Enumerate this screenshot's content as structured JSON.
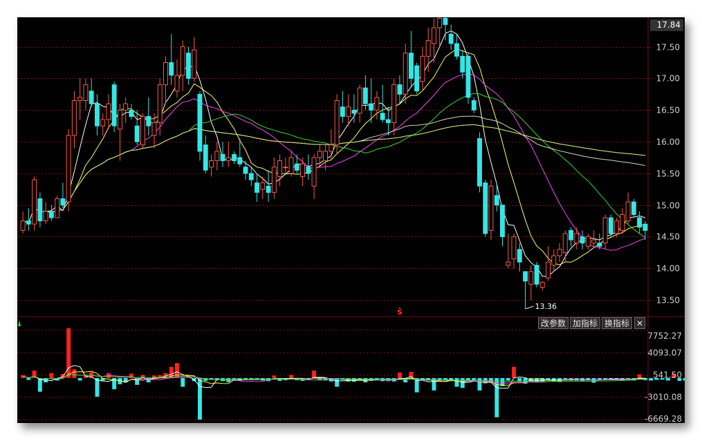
{
  "chart_data": {
    "type": "candlestick",
    "price_axis": {
      "ylim": [
        13.25,
        17.9
      ],
      "ticks": [
        "17.50",
        "17.00",
        "16.50",
        "16.00",
        "15.50",
        "15.00",
        "14.50",
        "14.00",
        "13.50"
      ],
      "current_label": "17.84"
    },
    "volume_axis": {
      "ylim": [
        -6669.28,
        7752.27
      ],
      "ticks": [
        "7752.27",
        "4093.07",
        "541.50",
        "-3010.08",
        "-6669.28"
      ]
    },
    "annotations": {
      "high_marker": "18.09",
      "low_marker": "13.36",
      "signal_marker": "ŝ"
    },
    "candles": [
      {
        "o": 14.6,
        "h": 14.9,
        "l": 14.55,
        "c": 14.75
      },
      {
        "o": 14.75,
        "h": 14.95,
        "l": 14.6,
        "c": 14.7
      },
      {
        "o": 14.7,
        "h": 15.45,
        "l": 14.6,
        "c": 15.4
      },
      {
        "o": 15.1,
        "h": 15.2,
        "l": 14.65,
        "c": 14.75
      },
      {
        "o": 14.75,
        "h": 15.05,
        "l": 14.7,
        "c": 14.9
      },
      {
        "o": 14.9,
        "h": 15.0,
        "l": 14.75,
        "c": 14.8
      },
      {
        "o": 14.8,
        "h": 15.15,
        "l": 14.8,
        "c": 15.1
      },
      {
        "o": 15.1,
        "h": 15.35,
        "l": 14.95,
        "c": 15.0
      },
      {
        "o": 15.05,
        "h": 16.2,
        "l": 14.9,
        "c": 16.1
      },
      {
        "o": 16.1,
        "h": 16.8,
        "l": 15.9,
        "c": 16.65
      },
      {
        "o": 16.65,
        "h": 17.0,
        "l": 16.35,
        "c": 16.7
      },
      {
        "o": 16.65,
        "h": 17.0,
        "l": 16.5,
        "c": 16.9
      },
      {
        "o": 16.8,
        "h": 17.0,
        "l": 16.55,
        "c": 16.6
      },
      {
        "o": 16.6,
        "h": 16.75,
        "l": 16.1,
        "c": 16.25
      },
      {
        "o": 16.25,
        "h": 16.45,
        "l": 16.1,
        "c": 16.35
      },
      {
        "o": 16.35,
        "h": 16.75,
        "l": 16.2,
        "c": 16.6
      },
      {
        "o": 16.9,
        "h": 16.95,
        "l": 16.15,
        "c": 16.25
      },
      {
        "o": 16.2,
        "h": 16.6,
        "l": 15.7,
        "c": 16.5
      },
      {
        "o": 16.5,
        "h": 16.7,
        "l": 16.3,
        "c": 16.6
      },
      {
        "o": 16.5,
        "h": 16.6,
        "l": 16.35,
        "c": 16.4
      },
      {
        "o": 16.25,
        "h": 16.5,
        "l": 15.95,
        "c": 16.0
      },
      {
        "o": 15.95,
        "h": 16.45,
        "l": 15.9,
        "c": 16.4
      },
      {
        "o": 16.4,
        "h": 16.7,
        "l": 16.1,
        "c": 16.25
      },
      {
        "o": 16.1,
        "h": 16.45,
        "l": 15.9,
        "c": 16.3
      },
      {
        "o": 16.3,
        "h": 17.0,
        "l": 16.1,
        "c": 16.9
      },
      {
        "o": 16.9,
        "h": 17.35,
        "l": 16.6,
        "c": 17.25
      },
      {
        "o": 17.25,
        "h": 17.7,
        "l": 16.9,
        "c": 17.05
      },
      {
        "o": 16.8,
        "h": 17.3,
        "l": 16.7,
        "c": 17.05
      },
      {
        "o": 17.05,
        "h": 17.6,
        "l": 16.8,
        "c": 17.5
      },
      {
        "o": 17.4,
        "h": 17.5,
        "l": 16.9,
        "c": 17.0
      },
      {
        "o": 17.0,
        "h": 17.65,
        "l": 16.95,
        "c": 17.45
      },
      {
        "o": 16.75,
        "h": 16.8,
        "l": 15.7,
        "c": 15.85
      },
      {
        "o": 15.95,
        "h": 16.1,
        "l": 15.5,
        "c": 15.55
      },
      {
        "o": 15.6,
        "h": 15.8,
        "l": 15.45,
        "c": 15.7
      },
      {
        "o": 15.7,
        "h": 16.0,
        "l": 15.55,
        "c": 15.85
      },
      {
        "o": 15.8,
        "h": 16.0,
        "l": 15.6,
        "c": 15.7
      },
      {
        "o": 15.7,
        "h": 16.0,
        "l": 15.6,
        "c": 15.75
      },
      {
        "o": 15.8,
        "h": 15.85,
        "l": 15.65,
        "c": 15.7
      },
      {
        "o": 15.75,
        "h": 16.05,
        "l": 15.6,
        "c": 15.65
      },
      {
        "o": 15.6,
        "h": 15.7,
        "l": 15.4,
        "c": 15.5
      },
      {
        "o": 15.5,
        "h": 15.6,
        "l": 15.3,
        "c": 15.4
      },
      {
        "o": 15.35,
        "h": 15.5,
        "l": 15.05,
        "c": 15.2
      },
      {
        "o": 15.25,
        "h": 15.45,
        "l": 15.1,
        "c": 15.35
      },
      {
        "o": 15.3,
        "h": 15.55,
        "l": 15.05,
        "c": 15.2
      },
      {
        "o": 15.2,
        "h": 15.75,
        "l": 15.1,
        "c": 15.6
      },
      {
        "o": 15.45,
        "h": 15.8,
        "l": 15.3,
        "c": 15.7
      },
      {
        "o": 15.6,
        "h": 15.75,
        "l": 15.5,
        "c": 15.6
      },
      {
        "o": 15.5,
        "h": 15.85,
        "l": 15.45,
        "c": 15.75
      },
      {
        "o": 15.65,
        "h": 15.8,
        "l": 15.5,
        "c": 15.55
      },
      {
        "o": 15.45,
        "h": 15.75,
        "l": 15.3,
        "c": 15.65
      },
      {
        "o": 15.6,
        "h": 15.8,
        "l": 15.4,
        "c": 15.5
      },
      {
        "o": 15.3,
        "h": 15.8,
        "l": 15.1,
        "c": 15.75
      },
      {
        "o": 15.75,
        "h": 15.95,
        "l": 15.6,
        "c": 15.85
      },
      {
        "o": 15.7,
        "h": 15.95,
        "l": 15.55,
        "c": 15.85
      },
      {
        "o": 15.85,
        "h": 16.2,
        "l": 15.7,
        "c": 15.95
      },
      {
        "o": 15.95,
        "h": 16.75,
        "l": 15.8,
        "c": 16.65
      },
      {
        "o": 16.55,
        "h": 16.8,
        "l": 16.3,
        "c": 16.4
      },
      {
        "o": 16.4,
        "h": 16.75,
        "l": 16.25,
        "c": 16.55
      },
      {
        "o": 16.5,
        "h": 16.75,
        "l": 16.3,
        "c": 16.45
      },
      {
        "o": 16.45,
        "h": 16.9,
        "l": 16.3,
        "c": 16.85
      },
      {
        "o": 16.85,
        "h": 17.05,
        "l": 16.5,
        "c": 16.6
      },
      {
        "o": 16.6,
        "h": 17.0,
        "l": 16.3,
        "c": 16.5
      },
      {
        "o": 16.5,
        "h": 16.8,
        "l": 16.35,
        "c": 16.7
      },
      {
        "o": 16.45,
        "h": 16.9,
        "l": 16.3,
        "c": 16.35
      },
      {
        "o": 16.35,
        "h": 16.55,
        "l": 16.1,
        "c": 16.3
      },
      {
        "o": 16.3,
        "h": 17.0,
        "l": 16.1,
        "c": 16.9
      },
      {
        "o": 16.9,
        "h": 17.05,
        "l": 16.6,
        "c": 16.75
      },
      {
        "o": 16.75,
        "h": 17.55,
        "l": 16.6,
        "c": 17.4
      },
      {
        "o": 17.4,
        "h": 17.75,
        "l": 16.85,
        "c": 17.0
      },
      {
        "o": 17.2,
        "h": 17.25,
        "l": 16.75,
        "c": 16.8
      },
      {
        "o": 16.95,
        "h": 17.5,
        "l": 16.8,
        "c": 17.35
      },
      {
        "o": 17.35,
        "h": 17.8,
        "l": 17.1,
        "c": 17.6
      },
      {
        "o": 17.55,
        "h": 17.95,
        "l": 17.25,
        "c": 17.8
      },
      {
        "o": 17.8,
        "h": 18.05,
        "l": 17.5,
        "c": 17.95
      },
      {
        "o": 17.95,
        "h": 18.09,
        "l": 17.6,
        "c": 17.85
      },
      {
        "o": 17.7,
        "h": 17.85,
        "l": 17.45,
        "c": 17.55
      },
      {
        "o": 17.55,
        "h": 17.7,
        "l": 17.3,
        "c": 17.35
      },
      {
        "o": 17.35,
        "h": 17.45,
        "l": 17.0,
        "c": 17.1
      },
      {
        "o": 17.35,
        "h": 17.4,
        "l": 16.6,
        "c": 16.7
      },
      {
        "o": 16.65,
        "h": 16.7,
        "l": 16.45,
        "c": 16.5
      },
      {
        "o": 16.05,
        "h": 16.15,
        "l": 15.2,
        "c": 15.3
      },
      {
        "o": 15.35,
        "h": 15.4,
        "l": 14.5,
        "c": 14.55
      },
      {
        "o": 14.6,
        "h": 15.4,
        "l": 14.45,
        "c": 15.3
      },
      {
        "o": 15.15,
        "h": 15.35,
        "l": 14.9,
        "c": 15.0
      },
      {
        "o": 15.0,
        "h": 15.0,
        "l": 14.35,
        "c": 14.5
      },
      {
        "o": 14.05,
        "h": 14.55,
        "l": 14.0,
        "c": 14.1
      },
      {
        "o": 14.15,
        "h": 14.55,
        "l": 14.0,
        "c": 14.5
      },
      {
        "o": 14.3,
        "h": 14.4,
        "l": 13.95,
        "c": 14.1
      },
      {
        "o": 13.95,
        "h": 13.95,
        "l": 13.36,
        "c": 13.8
      },
      {
        "o": 13.75,
        "h": 14.05,
        "l": 13.5,
        "c": 13.95
      },
      {
        "o": 14.05,
        "h": 14.1,
        "l": 13.7,
        "c": 13.75
      },
      {
        "o": 13.7,
        "h": 13.8,
        "l": 13.65,
        "c": 13.78
      },
      {
        "o": 13.85,
        "h": 14.35,
        "l": 13.8,
        "c": 14.1
      },
      {
        "o": 14.05,
        "h": 14.3,
        "l": 13.95,
        "c": 14.2
      },
      {
        "o": 14.2,
        "h": 14.4,
        "l": 14.1,
        "c": 14.3
      },
      {
        "o": 14.25,
        "h": 14.6,
        "l": 14.1,
        "c": 14.55
      },
      {
        "o": 14.6,
        "h": 14.65,
        "l": 14.35,
        "c": 14.45
      },
      {
        "o": 14.4,
        "h": 14.65,
        "l": 14.3,
        "c": 14.55
      },
      {
        "o": 14.5,
        "h": 14.6,
        "l": 14.3,
        "c": 14.4
      },
      {
        "o": 14.35,
        "h": 14.55,
        "l": 14.3,
        "c": 14.5
      },
      {
        "o": 14.4,
        "h": 14.6,
        "l": 14.35,
        "c": 14.45
      },
      {
        "o": 14.4,
        "h": 14.55,
        "l": 14.3,
        "c": 14.35
      },
      {
        "o": 14.4,
        "h": 14.85,
        "l": 14.3,
        "c": 14.8
      },
      {
        "o": 14.8,
        "h": 14.85,
        "l": 14.5,
        "c": 14.55
      },
      {
        "o": 14.55,
        "h": 14.8,
        "l": 14.5,
        "c": 14.75
      },
      {
        "o": 14.6,
        "h": 14.95,
        "l": 14.55,
        "c": 14.85
      },
      {
        "o": 14.75,
        "h": 15.2,
        "l": 14.7,
        "c": 15.05
      },
      {
        "o": 15.05,
        "h": 15.1,
        "l": 14.8,
        "c": 14.85
      },
      {
        "o": 14.8,
        "h": 14.9,
        "l": 14.55,
        "c": 14.65
      },
      {
        "o": 14.7,
        "h": 14.75,
        "l": 14.45,
        "c": 14.6
      }
    ],
    "volume": [
      450,
      -300,
      1200,
      -2200,
      -700,
      800,
      -400,
      650,
      8000,
      1400,
      -400,
      400,
      950,
      -3000,
      -400,
      800,
      -1800,
      -1000,
      -700,
      700,
      -1100,
      500,
      -700,
      400,
      450,
      800,
      1800,
      2400,
      -1400,
      400,
      -500,
      -6669,
      -450,
      -300,
      -350,
      -500,
      -650,
      -450,
      -450,
      -350,
      -300,
      -300,
      -400,
      -500,
      400,
      -450,
      -350,
      500,
      -350,
      -450,
      -250,
      1200,
      -350,
      -400,
      -550,
      -1400,
      -300,
      -550,
      -600,
      -400,
      -700,
      -450,
      -350,
      -500,
      -500,
      -550,
      900,
      -700,
      1000,
      -2300,
      -350,
      -400,
      -2000,
      -300,
      -400,
      -500,
      -1400,
      -1600,
      -500,
      -400,
      -2000,
      -850,
      -700,
      -6300,
      -1300,
      -400,
      1800,
      -600,
      -900,
      -500,
      -700,
      -550,
      -400,
      -500,
      -650,
      -400,
      -400,
      -400,
      -550,
      -400,
      -750,
      -350,
      -300,
      -250,
      -300,
      -400,
      -250,
      -400,
      600,
      -350,
      -400,
      -300,
      -250,
      -400,
      700,
      -450,
      -400,
      -500
    ],
    "moving_averages": [
      {
        "period": 5,
        "color": "#ffffff"
      },
      {
        "period": 10,
        "color": "#ffff66"
      },
      {
        "period": 20,
        "color": "#ff44ff"
      },
      {
        "period": 30,
        "color": "#33dd33"
      },
      {
        "period": 60,
        "color": "#d8d8c0"
      },
      {
        "period": 120,
        "color": "#22bbee"
      },
      {
        "period": 250,
        "color": "#dddd66"
      }
    ],
    "colors": {
      "up": "#ff5a4a",
      "down": "#33e6e6",
      "grid": "#7a1010",
      "axis_text": "#d0d0d0",
      "volume_up": "#ff2020"
    },
    "grid": true
  },
  "toolbar": {
    "modify_params": "改参数",
    "add_indicator": "加指标",
    "switch_indicator": "换指标",
    "close": "✕"
  }
}
